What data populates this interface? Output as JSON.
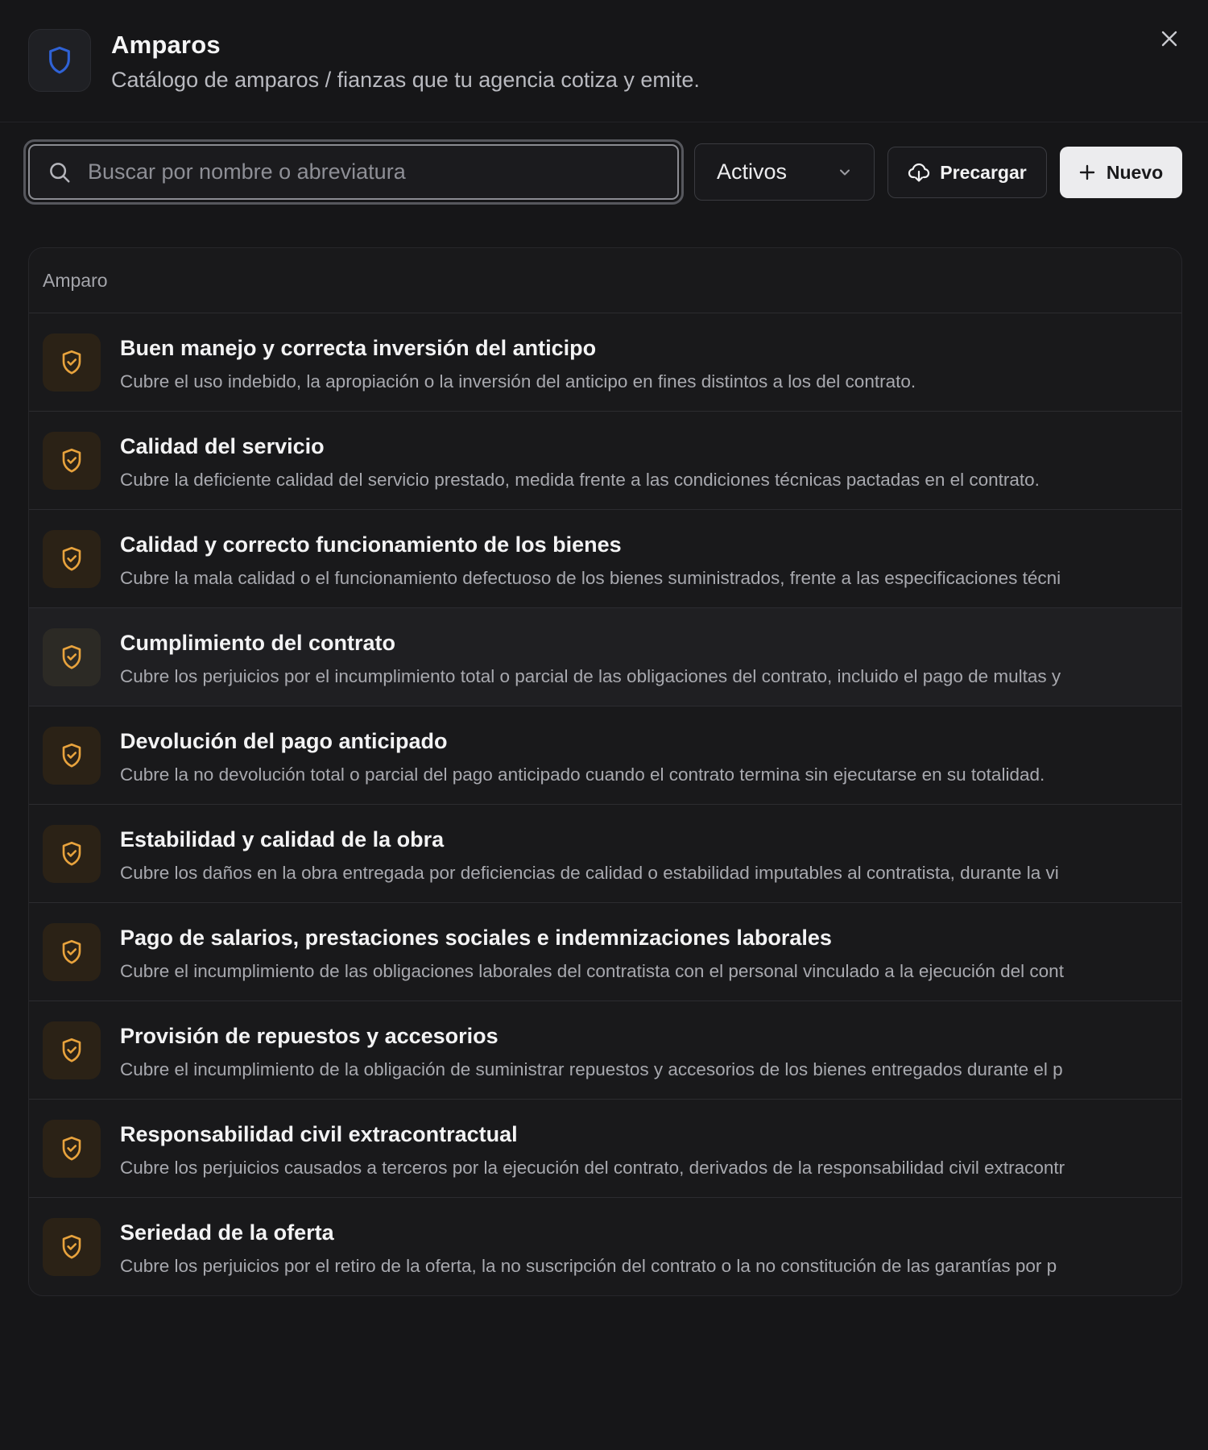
{
  "header": {
    "title": "Amparos",
    "subtitle": "Catálogo de amparos / fianzas que tu agencia cotiza y emite.",
    "icon": "shield-icon",
    "icon_color": "#2f62d6"
  },
  "toolbar": {
    "search_placeholder": "Buscar por nombre o abreviatura",
    "search_value": "",
    "status_filter": "Activos",
    "preload_label": "Precargar",
    "new_label": "Nuevo"
  },
  "table": {
    "column_header": "Amparo",
    "icon": "shield-check-icon",
    "icon_color": "#e8a33d",
    "rows": [
      {
        "title": "Buen manejo y correcta inversión del anticipo",
        "description": "Cubre el uso indebido, la apropiación o la inversión del anticipo en fines distintos a los del contrato."
      },
      {
        "title": "Calidad del servicio",
        "description": "Cubre la deficiente calidad del servicio prestado, medida frente a las condiciones técnicas pactadas en el contrato."
      },
      {
        "title": "Calidad y correcto funcionamiento de los bienes",
        "description": "Cubre la mala calidad o el funcionamiento defectuoso de los bienes suministrados, frente a las especificaciones técni"
      },
      {
        "title": "Cumplimiento del contrato",
        "description": "Cubre los perjuicios por el incumplimiento total o parcial de las obligaciones del contrato, incluido el pago de multas y"
      },
      {
        "title": "Devolución del pago anticipado",
        "description": "Cubre la no devolución total o parcial del pago anticipado cuando el contrato termina sin ejecutarse en su totalidad."
      },
      {
        "title": "Estabilidad y calidad de la obra",
        "description": "Cubre los daños en la obra entregada por deficiencias de calidad o estabilidad imputables al contratista, durante la vi"
      },
      {
        "title": "Pago de salarios, prestaciones sociales e indemnizaciones laborales",
        "description": "Cubre el incumplimiento de las obligaciones laborales del contratista con el personal vinculado a la ejecución del cont"
      },
      {
        "title": "Provisión de repuestos y accesorios",
        "description": "Cubre el incumplimiento de la obligación de suministrar repuestos y accesorios de los bienes entregados durante el p"
      },
      {
        "title": "Responsabilidad civil extracontractual",
        "description": "Cubre los perjuicios causados a terceros por la ejecución del contrato, derivados de la responsabilidad civil extracontr"
      },
      {
        "title": "Seriedad de la oferta",
        "description": "Cubre los perjuicios por el retiro de la oferta, la no suscripción del contrato o la no constitución de las garantías por p"
      }
    ]
  }
}
